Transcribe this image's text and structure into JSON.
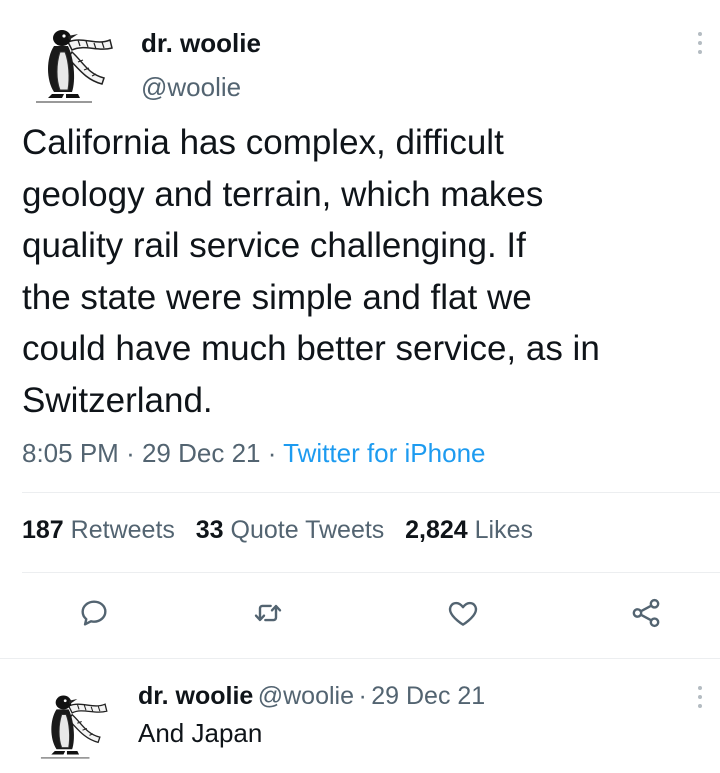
{
  "tweet": {
    "display_name": "dr. woolie",
    "handle": "@woolie",
    "text_lines": [
      "California has complex, difficult",
      "geology and terrain, which makes",
      "quality rail service challenging. If",
      "the state were simple and flat we",
      "could have much better service, as in",
      "Switzerland."
    ],
    "time": "8:05 PM",
    "date": "29 Dec 21",
    "separator": "·",
    "source": "Twitter for iPhone",
    "stats": {
      "retweets_count": "187",
      "retweets_label": "Retweets",
      "quotes_count": "33",
      "quotes_label": "Quote Tweets",
      "likes_count": "2,824",
      "likes_label": "Likes"
    },
    "actions": {
      "reply_icon": "reply-icon",
      "retweet_icon": "retweet-icon",
      "like_icon": "heart-icon",
      "share_icon": "share-icon"
    }
  },
  "reply": {
    "display_name": "dr. woolie",
    "handle": "@woolie",
    "separator": "·",
    "date": "29 Dec 21",
    "text": "And Japan"
  },
  "colors": {
    "text": "#0f1419",
    "secondary": "#536471",
    "accent": "#1d9bf0",
    "divider": "#eceef0"
  }
}
